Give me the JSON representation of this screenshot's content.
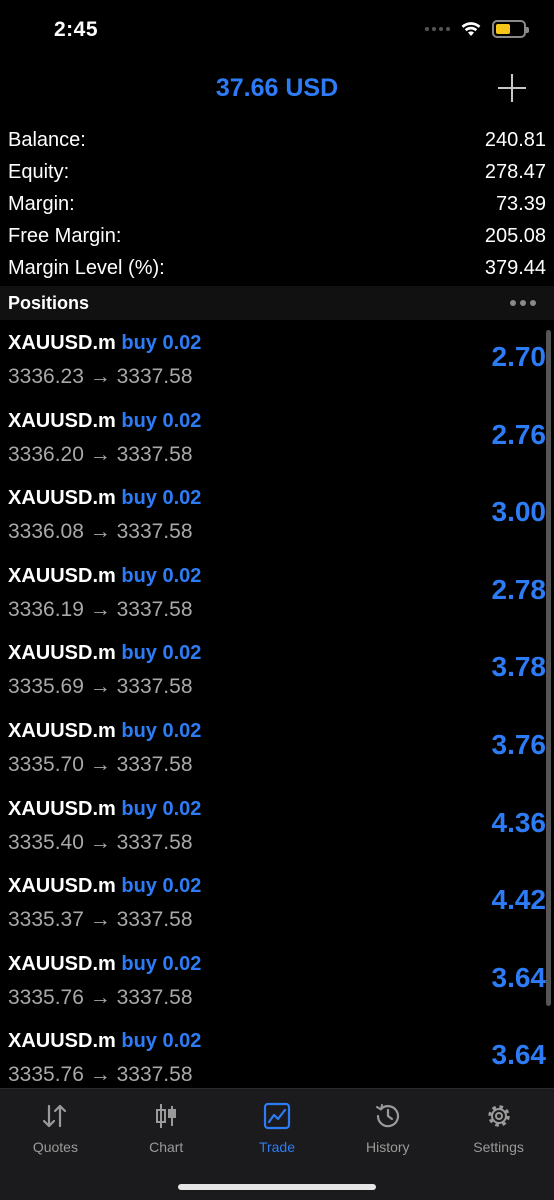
{
  "status": {
    "time": "2:45"
  },
  "header": {
    "title": "37.66 USD"
  },
  "summary": [
    {
      "label": "Balance:",
      "value": "240.81"
    },
    {
      "label": "Equity:",
      "value": "278.47"
    },
    {
      "label": "Margin:",
      "value": "73.39"
    },
    {
      "label": "Free Margin:",
      "value": "205.08"
    },
    {
      "label": "Margin Level (%):",
      "value": "379.44"
    }
  ],
  "positions_title": "Positions",
  "positions": [
    {
      "symbol": "XAUUSD.m",
      "type": "buy 0.02",
      "open": "3336.23",
      "current": "3337.58",
      "profit": "2.70"
    },
    {
      "symbol": "XAUUSD.m",
      "type": "buy 0.02",
      "open": "3336.20",
      "current": "3337.58",
      "profit": "2.76"
    },
    {
      "symbol": "XAUUSD.m",
      "type": "buy 0.02",
      "open": "3336.08",
      "current": "3337.58",
      "profit": "3.00"
    },
    {
      "symbol": "XAUUSD.m",
      "type": "buy 0.02",
      "open": "3336.19",
      "current": "3337.58",
      "profit": "2.78"
    },
    {
      "symbol": "XAUUSD.m",
      "type": "buy 0.02",
      "open": "3335.69",
      "current": "3337.58",
      "profit": "3.78"
    },
    {
      "symbol": "XAUUSD.m",
      "type": "buy 0.02",
      "open": "3335.70",
      "current": "3337.58",
      "profit": "3.76"
    },
    {
      "symbol": "XAUUSD.m",
      "type": "buy 0.02",
      "open": "3335.40",
      "current": "3337.58",
      "profit": "4.36"
    },
    {
      "symbol": "XAUUSD.m",
      "type": "buy 0.02",
      "open": "3335.37",
      "current": "3337.58",
      "profit": "4.42"
    },
    {
      "symbol": "XAUUSD.m",
      "type": "buy 0.02",
      "open": "3335.76",
      "current": "3337.58",
      "profit": "3.64"
    },
    {
      "symbol": "XAUUSD.m",
      "type": "buy 0.02",
      "open": "3335.76",
      "current": "3337.58",
      "profit": "3.64"
    }
  ],
  "tabs": [
    {
      "label": "Quotes",
      "icon": "quotes-icon"
    },
    {
      "label": "Chart",
      "icon": "candlestick-icon"
    },
    {
      "label": "Trade",
      "icon": "trade-chart-icon",
      "active": true
    },
    {
      "label": "History",
      "icon": "history-icon"
    },
    {
      "label": "Settings",
      "icon": "gear-icon"
    }
  ],
  "colors": {
    "accent": "#2d7cf6",
    "background": "#000000",
    "tab_bar": "#1b1b1d"
  }
}
